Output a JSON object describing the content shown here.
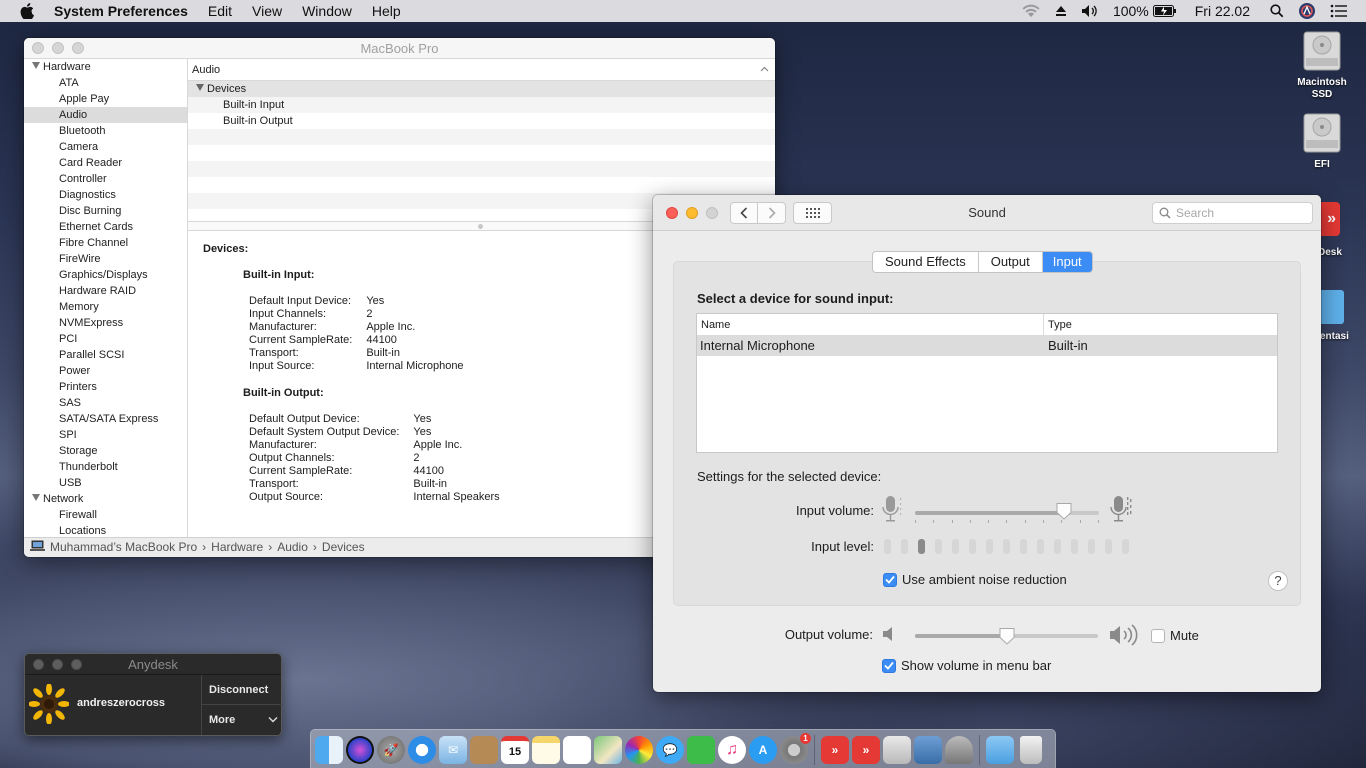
{
  "menubar": {
    "app_name": "System Preferences",
    "menus": [
      "Edit",
      "View",
      "Window",
      "Help"
    ],
    "battery": "100%",
    "clock": "Fri 22.02"
  },
  "sysinfo": {
    "title": "MacBook Pro",
    "sidebar": {
      "hardware_label": "Hardware",
      "hardware_items": [
        "ATA",
        "Apple Pay",
        "Audio",
        "Bluetooth",
        "Camera",
        "Card Reader",
        "Controller",
        "Diagnostics",
        "Disc Burning",
        "Ethernet Cards",
        "Fibre Channel",
        "FireWire",
        "Graphics/Displays",
        "Hardware RAID",
        "Memory",
        "NVMExpress",
        "PCI",
        "Parallel SCSI",
        "Power",
        "Printers",
        "SAS",
        "SATA/SATA Express",
        "SPI",
        "Storage",
        "Thunderbolt",
        "USB"
      ],
      "selected": "Audio",
      "network_label": "Network",
      "network_items": [
        "Firewall",
        "Locations"
      ]
    },
    "column_header": "Audio",
    "tree": {
      "group": "Devices",
      "leaves": [
        "Built-in Input",
        "Built-in Output"
      ]
    },
    "detail": {
      "heading": "Devices:",
      "input": {
        "title": "Built-in Input:",
        "rows": [
          [
            "Default Input Device:",
            "Yes"
          ],
          [
            "Input Channels:",
            "2"
          ],
          [
            "Manufacturer:",
            "Apple Inc."
          ],
          [
            "Current SampleRate:",
            "44100"
          ],
          [
            "Transport:",
            "Built-in"
          ],
          [
            "Input Source:",
            "Internal Microphone"
          ]
        ]
      },
      "output": {
        "title": "Built-in Output:",
        "rows": [
          [
            "Default Output Device:",
            "Yes"
          ],
          [
            "Default System Output Device:",
            "Yes"
          ],
          [
            "Manufacturer:",
            "Apple Inc."
          ],
          [
            "Output Channels:",
            "2"
          ],
          [
            "Current SampleRate:",
            "44100"
          ],
          [
            "Transport:",
            "Built-in"
          ],
          [
            "Output Source:",
            "Internal Speakers"
          ]
        ]
      }
    },
    "breadcrumb": [
      "Muhammad’s MacBook Pro",
      "Hardware",
      "Audio",
      "Devices"
    ]
  },
  "sound": {
    "title": "Sound",
    "search_placeholder": "Search",
    "tabs": [
      "Sound Effects",
      "Output",
      "Input"
    ],
    "active_tab": "Input",
    "select_label": "Select a device for sound input:",
    "table_headers": [
      "Name",
      "Type"
    ],
    "devices": [
      {
        "name": "Internal Microphone",
        "type": "Built-in"
      }
    ],
    "settings_label": "Settings for the selected device:",
    "input_volume_label": "Input volume:",
    "input_volume": 0.81,
    "input_level_label": "Input level:",
    "input_level_bars": 15,
    "input_level_active": 3,
    "ambient_label": "Use ambient noise reduction",
    "ambient_checked": true,
    "help_label": "?",
    "output_volume_label": "Output volume:",
    "output_volume": 0.5,
    "mute_label": "Mute",
    "mute_checked": false,
    "show_volume_label": "Show volume in menu bar",
    "show_volume_checked": true
  },
  "anydesk": {
    "title": "Anydesk",
    "user": "andreszerocross",
    "disconnect": "Disconnect",
    "more": "More"
  },
  "desktop": {
    "icons": [
      {
        "label": "Macintosh SSD"
      },
      {
        "label": "EFI"
      }
    ],
    "partial_labels": [
      "Desk",
      "entasi"
    ]
  },
  "dock": {
    "calendar_day": "15",
    "prefs_badge": "1",
    "apps": [
      "Finder",
      "Siri",
      "Launchpad",
      "Safari",
      "Mail",
      "Contacts",
      "Calendar",
      "Notes",
      "Reminders",
      "Maps",
      "Photos",
      "Messages",
      "FaceTime",
      "iTunes",
      "App Store",
      "System Preferences",
      "AnyDesk",
      "AnyDesk",
      "Preview",
      "Screenshot",
      "Automator",
      "Downloads",
      "Trash"
    ]
  },
  "colors": {
    "accent": "#3c8cf5",
    "close": "#fc5f57",
    "minimize": "#fdbc2e",
    "anydesk_red": "#e53935"
  }
}
